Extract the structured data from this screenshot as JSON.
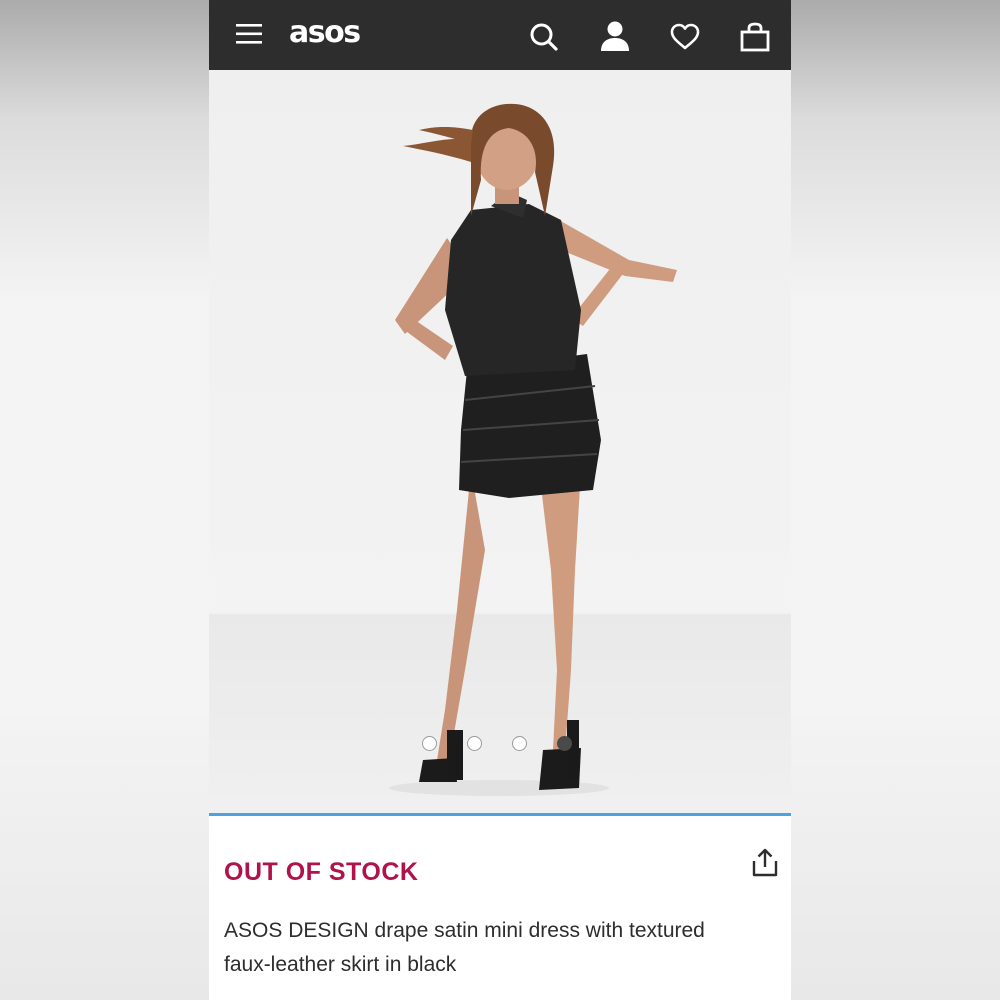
{
  "header": {
    "logo": "asos",
    "menu_icon": "hamburger-menu-icon",
    "search_icon": "search-icon",
    "account_icon": "account-icon",
    "wishlist_icon": "heart-icon",
    "bag_icon": "shopping-bag-icon"
  },
  "gallery": {
    "image_count": 4,
    "active_index": 3
  },
  "product": {
    "status": "OUT OF STOCK",
    "name": "ASOS DESIGN drape satin mini dress with textured faux-leather skirt in black",
    "share_icon": "share-icon"
  },
  "colors": {
    "header_bg": "#2d2d2d",
    "status": "#b0134a",
    "accent": "#4aa3df"
  }
}
